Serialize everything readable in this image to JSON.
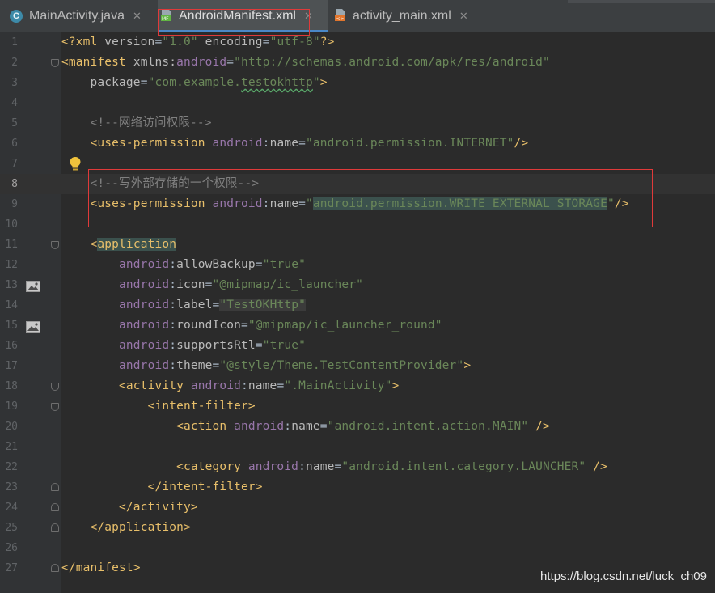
{
  "tabs": [
    {
      "label": "MainActivity.java",
      "icon": "class-icon",
      "active": false
    },
    {
      "label": "AndroidManifest.xml",
      "icon": "manifest-file-icon",
      "icon_text": "MF",
      "active": true
    },
    {
      "label": "activity_main.xml",
      "icon": "layout-file-icon",
      "icon_text": "<>",
      "active": false
    }
  ],
  "close_glyph": "✕",
  "editor": {
    "caret_line": 8,
    "line_numbers": [
      "1",
      "2",
      "3",
      "4",
      "5",
      "6",
      "7",
      "8",
      "9",
      "10",
      "11",
      "12",
      "13",
      "14",
      "15",
      "16",
      "17",
      "18",
      "19",
      "20",
      "21",
      "22",
      "23",
      "24",
      "25",
      "26",
      "27"
    ],
    "lines": {
      "l1": {
        "pi_open": "<?xml ",
        "a1": "version",
        "eq1": "=",
        "v1": "\"1.0\"",
        "sp": " ",
        "a2": "encoding",
        "eq2": "=",
        "v2": "\"utf-8\"",
        "pi_close": "?>"
      },
      "l2": {
        "tag": "<manifest ",
        "a1": "xmlns:",
        "ns": "android",
        "eq": "=",
        "v": "\"http://schemas.android.com/apk/res/android\""
      },
      "l3": {
        "a": "package",
        "eq": "=",
        "v1": "\"com.example.",
        "v2": "testokhttp",
        "v3": "\"",
        "tag": ">"
      },
      "l5": {
        "c": "<!--网络访问权限-->"
      },
      "l6": {
        "tag": "<uses-permission ",
        "ns": "android",
        "colon": ":",
        "a": "name",
        "eq": "=",
        "v": "\"android.permission.INTERNET\"",
        "end": "/>"
      },
      "l8": {
        "c": "<!--写外部存储的一个权限-->"
      },
      "l9": {
        "tag": "<uses-permission ",
        "ns": "android",
        "colon": ":",
        "a": "name",
        "eq": "=",
        "q1": "\"",
        "v": "android.permission.WRITE_EXTERNAL_STORAGE",
        "q2": "\"",
        "end": "/>"
      },
      "l11": {
        "lt": "<",
        "tag": "application"
      },
      "l12": {
        "ns": "android",
        "colon": ":",
        "a": "allowBackup",
        "eq": "=",
        "v": "\"true\""
      },
      "l13": {
        "ns": "android",
        "colon": ":",
        "a": "icon",
        "eq": "=",
        "v": "\"@mipmap/ic_launcher\""
      },
      "l14": {
        "ns": "android",
        "colon": ":",
        "a": "label",
        "eq": "=",
        "v": "\"TestOKHttp\""
      },
      "l15": {
        "ns": "android",
        "colon": ":",
        "a": "roundIcon",
        "eq": "=",
        "v": "\"@mipmap/ic_launcher_round\""
      },
      "l16": {
        "ns": "android",
        "colon": ":",
        "a": "supportsRtl",
        "eq": "=",
        "v": "\"true\""
      },
      "l17": {
        "ns": "android",
        "colon": ":",
        "a": "theme",
        "eq": "=",
        "v": "\"@style/Theme.TestContentProvider\"",
        "tag": ">"
      },
      "l18": {
        "tag": "<activity ",
        "ns": "android",
        "colon": ":",
        "a": "name",
        "eq": "=",
        "v": "\".MainActivity\"",
        "end": ">"
      },
      "l19": {
        "tag": "<intent-filter>"
      },
      "l20": {
        "tag": "<action ",
        "ns": "android",
        "colon": ":",
        "a": "name",
        "eq": "=",
        "v": "\"android.intent.action.MAIN\"",
        "end": " />"
      },
      "l22": {
        "tag": "<category ",
        "ns": "android",
        "colon": ":",
        "a": "name",
        "eq": "=",
        "v": "\"android.intent.category.LAUNCHER\"",
        "end": " />"
      },
      "l23": {
        "tag": "</intent-filter>"
      },
      "l24": {
        "tag": "</activity>"
      },
      "l25": {
        "tag": "</application>"
      },
      "l27": {
        "tag": "</manifest>"
      }
    }
  },
  "watermark": "https://blog.csdn.net/luck_ch09",
  "colors": {
    "background": "#2b2b2b",
    "tag": "#e8bf6a",
    "namespace": "#9876aa",
    "string": "#6a8759",
    "comment": "#808080",
    "highlight_box": "#e03a3a",
    "active_tab_underline": "#4a88c7"
  }
}
